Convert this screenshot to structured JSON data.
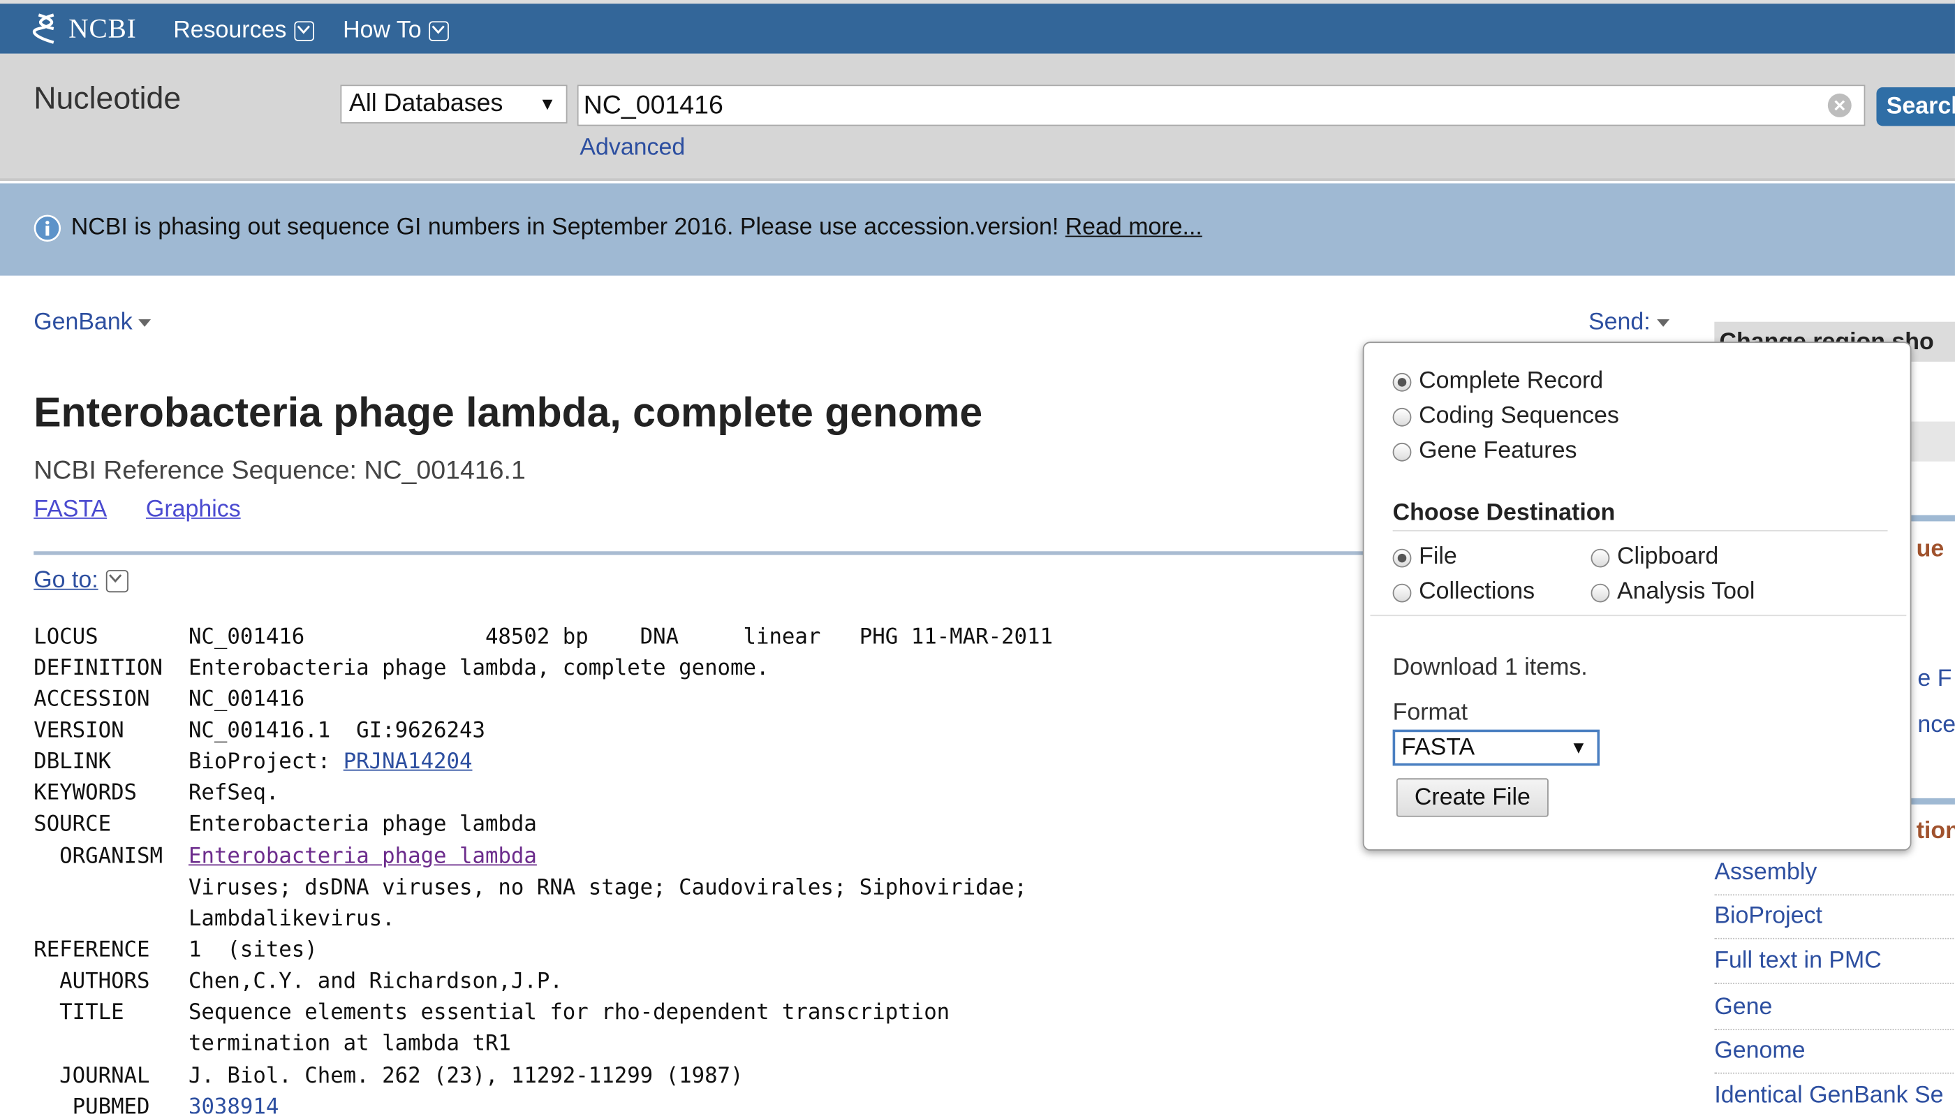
{
  "header": {
    "logo_text": "NCBI",
    "nav": [
      {
        "label": "Resources"
      },
      {
        "label": "How To"
      }
    ]
  },
  "search": {
    "database_name": "Nucleotide",
    "db_select_value": "All Databases",
    "query": "NC_001416",
    "search_button": "Search",
    "advanced_link": "Advanced"
  },
  "banner": {
    "message": "NCBI is phasing out sequence GI numbers in September 2016. Please use accession.version!",
    "link": "Read more..."
  },
  "record": {
    "format_label": "GenBank",
    "send_label": "Send:",
    "title": "Enterobacteria phage lambda, complete genome",
    "refseq": "NCBI Reference Sequence: NC_001416.1",
    "links": [
      "FASTA",
      "Graphics"
    ],
    "goto": "Go to:"
  },
  "flatfile": {
    "locus": "LOCUS       NC_001416              48502 bp    DNA     linear   PHG 11-MAR-2011",
    "definition": "DEFINITION  Enterobacteria phage lambda, complete genome.",
    "accession": "ACCESSION   NC_001416",
    "version": "VERSION     NC_001416.1  GI:9626243",
    "dblink_prefix": "DBLINK      BioProject: ",
    "dblink_link": "PRJNA14204",
    "keywords": "KEYWORDS    RefSeq.",
    "source": "SOURCE      Enterobacteria phage lambda",
    "organism_prefix": "  ORGANISM  ",
    "organism_link": "Enterobacteria phage lambda",
    "taxonomy1": "            Viruses; dsDNA viruses, no RNA stage; Caudovirales; Siphoviridae;",
    "taxonomy2": "            Lambdalikevirus.",
    "reference": "REFERENCE   1  (sites)",
    "authors": "  AUTHORS   Chen,C.Y. and Richardson,J.P.",
    "title1": "  TITLE     Sequence elements essential for rho-dependent transcription",
    "title2": "            termination at lambda tR1",
    "journal": "  JOURNAL   J. Biol. Chem. 262 (23), 11292-11299 (1987)",
    "pubmed_prefix": "   PUBMED   ",
    "pubmed_link": "3038914"
  },
  "sidebar": {
    "fragments": [
      "Change region sho",
      "ue",
      "e F",
      "nce",
      "tion"
    ],
    "links": [
      "Assembly",
      "BioProject",
      "Full text in PMC",
      "Gene",
      "Genome",
      "Identical GenBank Se"
    ]
  },
  "send_popup": {
    "record_options": [
      {
        "label": "Complete Record",
        "selected": true
      },
      {
        "label": "Coding Sequences",
        "selected": false
      },
      {
        "label": "Gene Features",
        "selected": false
      }
    ],
    "choose_destination": "Choose Destination",
    "destinations": [
      {
        "label": "File",
        "selected": true
      },
      {
        "label": "Clipboard",
        "selected": false
      },
      {
        "label": "Collections",
        "selected": false
      },
      {
        "label": "Analysis Tool",
        "selected": false
      }
    ],
    "download_text": "Download 1 items.",
    "format_label": "Format",
    "format_value": "FASTA",
    "create_button": "Create File"
  },
  "colors": {
    "header_bg": "#336699",
    "search_band_bg": "#d6d6d6",
    "banner_bg": "#9fb9d3",
    "link": "#2d4fa0",
    "search_button": "#2f6ea6"
  }
}
